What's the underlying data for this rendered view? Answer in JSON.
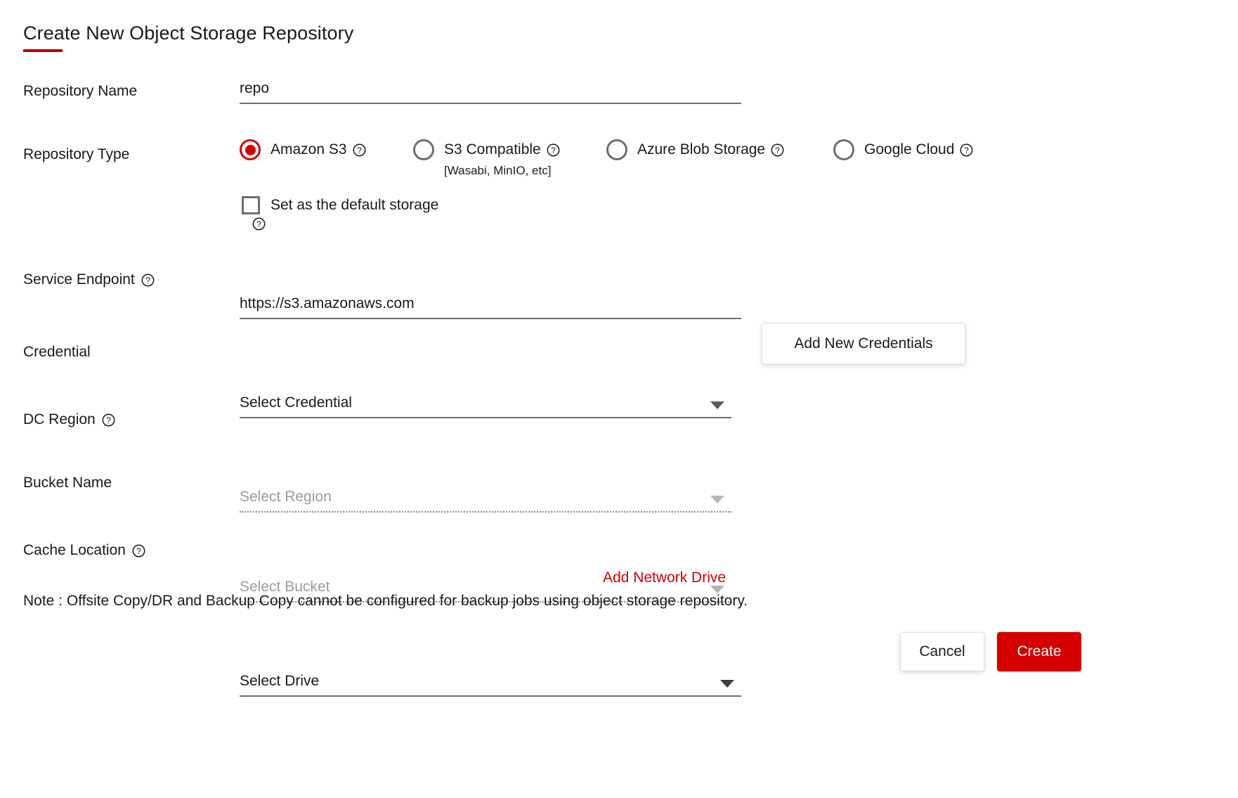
{
  "dialog": {
    "title": "Create New Object Storage Repository",
    "accent_color": "#c00000",
    "brand_red": "#d40000"
  },
  "fields": {
    "repository_name": {
      "label": "Repository Name",
      "value": "repo",
      "placeholder": "",
      "state": "enabled"
    },
    "repository_type": {
      "label": "Repository Type"
    },
    "service_endpoint": {
      "label": "Service Endpoint",
      "value": "https://s3.amazonaws.com",
      "state": "enabled",
      "help_icon": "question-circle-icon"
    },
    "credential": {
      "label": "Credential",
      "value": "Select Credential",
      "state": "enabled",
      "caret_icon": "chevron-down-icon"
    },
    "dc_region": {
      "label": "DC Region",
      "value": "Select Region",
      "state": "disabled",
      "help_icon": "question-circle-icon",
      "caret_icon": "chevron-down-icon"
    },
    "bucket_name": {
      "label": "Bucket Name",
      "value": "Select Bucket",
      "state": "disabled",
      "caret_icon": "chevron-down-icon"
    },
    "cache_location": {
      "label": "Cache Location",
      "value": "Select Drive",
      "state": "enabled",
      "help_icon": "question-circle-icon",
      "caret_icon": "chevron-down-icon"
    }
  },
  "repository_type_options": [
    {
      "label": "Amazon S3",
      "sub": "",
      "selected": true,
      "help_icon": "question-circle-icon"
    },
    {
      "label": "S3 Compatible",
      "sub": "[Wasabi, MinIO, etc]",
      "selected": false,
      "help_icon": "question-circle-icon"
    },
    {
      "label": "Azure Blob Storage",
      "sub": "",
      "selected": false,
      "help_icon": "question-circle-icon"
    },
    {
      "label": "Google Cloud",
      "sub": "",
      "selected": false,
      "help_icon": "question-circle-icon"
    }
  ],
  "default_storage": {
    "label": "Set as the default storage",
    "checked": false,
    "help_icon": "question-circle-icon"
  },
  "actions": {
    "add_new_credentials": "Add New Credentials",
    "add_network_drive": "Add Network Drive",
    "cancel": "Cancel",
    "create": "Create"
  },
  "note": "Note : Offsite Copy/DR and Backup Copy cannot be configured for backup jobs using object storage repository."
}
